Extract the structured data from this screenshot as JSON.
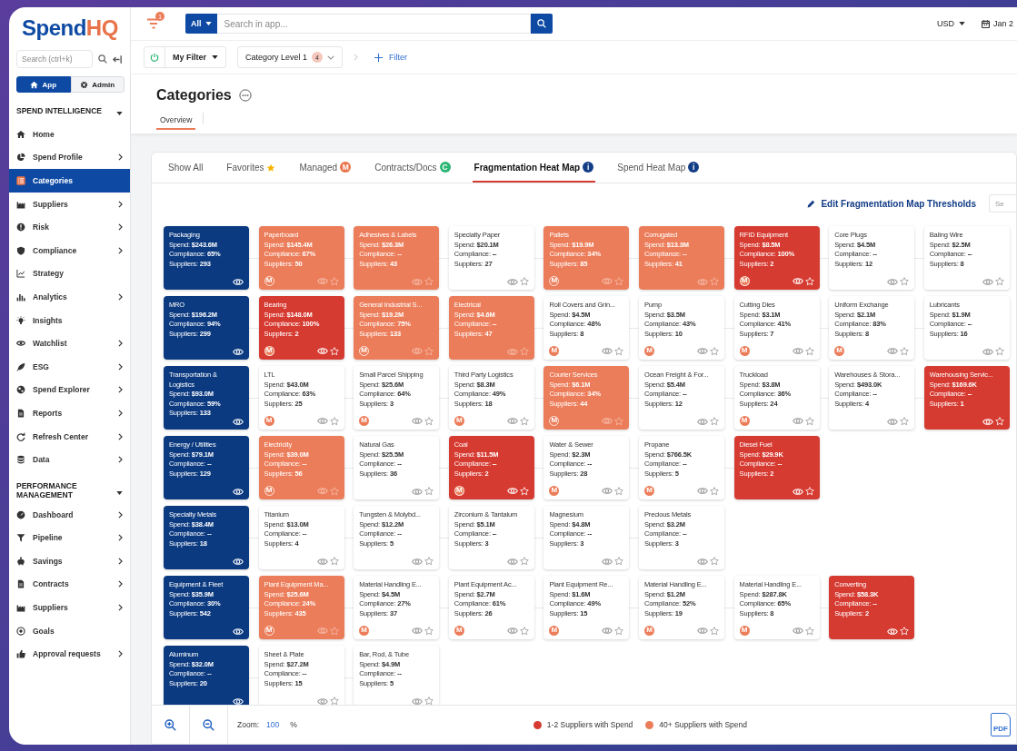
{
  "sidebar": {
    "logo": {
      "main": "Spend",
      "accent": "HQ"
    },
    "search": {
      "placeholder": "Search (ctrl+k)"
    },
    "modes": [
      {
        "label": "App",
        "selected": true
      },
      {
        "label": "Admin",
        "selected": false
      }
    ],
    "sections": [
      {
        "title": "SPEND INTELLIGENCE",
        "expanded": true,
        "items": [
          {
            "label": "Home",
            "has_submenu": false,
            "selected": false
          },
          {
            "label": "Spend Profile",
            "has_submenu": true,
            "selected": false
          },
          {
            "label": "Categories",
            "has_submenu": false,
            "selected": true
          },
          {
            "label": "Suppliers",
            "has_submenu": true,
            "selected": false
          },
          {
            "label": "Risk",
            "has_submenu": true,
            "selected": false
          },
          {
            "label": "Compliance",
            "has_submenu": true,
            "selected": false
          },
          {
            "label": "Strategy",
            "has_submenu": false,
            "selected": false
          },
          {
            "label": "Analytics",
            "has_submenu": true,
            "selected": false
          },
          {
            "label": "Insights",
            "has_submenu": false,
            "selected": false
          },
          {
            "label": "Watchlist",
            "has_submenu": true,
            "selected": false
          },
          {
            "label": "ESG",
            "has_submenu": true,
            "selected": false
          },
          {
            "label": "Spend Explorer",
            "has_submenu": true,
            "selected": false
          },
          {
            "label": "Reports",
            "has_submenu": true,
            "selected": false
          },
          {
            "label": "Refresh Center",
            "has_submenu": true,
            "selected": false
          },
          {
            "label": "Data",
            "has_submenu": true,
            "selected": false
          }
        ]
      },
      {
        "title": "PERFORMANCE MANAGEMENT",
        "expanded": true,
        "items": [
          {
            "label": "Dashboard",
            "has_submenu": true,
            "selected": false
          },
          {
            "label": "Pipeline",
            "has_submenu": true,
            "selected": false
          },
          {
            "label": "Savings",
            "has_submenu": true,
            "selected": false
          },
          {
            "label": "Contracts",
            "has_submenu": true,
            "selected": false
          },
          {
            "label": "Suppliers",
            "has_submenu": true,
            "selected": false
          },
          {
            "label": "Goals",
            "has_submenu": false,
            "selected": false
          },
          {
            "label": "Approval requests",
            "has_submenu": true,
            "selected": false
          }
        ]
      }
    ]
  },
  "top_bar": {
    "filter_badge": "1",
    "scope": "All",
    "search": {
      "placeholder": "Search in app..."
    },
    "currency": "USD",
    "date": "Jan 2"
  },
  "filter_bar": {
    "filter_name": "My Filter",
    "chips": [
      {
        "label": "Category Level 1",
        "count": "4"
      }
    ],
    "add_filter": "Filter"
  },
  "page": {
    "title": "Categories",
    "tabs": [
      {
        "label": "Overview",
        "selected": true
      }
    ]
  },
  "panel": {
    "tabs": [
      {
        "label": "Show All",
        "selected": false
      },
      {
        "label": "Favorites",
        "selected": false,
        "marker": {
          "kind": "star"
        }
      },
      {
        "label": "Managed",
        "selected": false,
        "marker": {
          "kind": "letter",
          "text": "M",
          "color": "#e8734a"
        }
      },
      {
        "label": "Contracts/Docs",
        "selected": false,
        "marker": {
          "kind": "letter",
          "text": "C",
          "color": "#2bb673"
        }
      },
      {
        "label": "Fragmentation Heat Map",
        "selected": true,
        "marker": {
          "kind": "letter",
          "text": "i",
          "color": "#123d86"
        }
      },
      {
        "label": "Spend Heat Map",
        "selected": false,
        "marker": {
          "kind": "letter",
          "text": "i",
          "color": "#123d86"
        }
      }
    ],
    "edit_link": "Edit Fragmentation Map Thresholds",
    "side_field": "Se",
    "rows": [
      [
        {
          "name": "Packaging",
          "kind": "parent",
          "lines": [
            "Spend: **$243.6M**",
            "Compliance: **65%**",
            "Suppliers: **293**"
          ]
        },
        {
          "name": "Paperboard",
          "kind": "high",
          "badge": "M",
          "lines": [
            "Spend: **$145.4M**",
            "Compliance: **67%**",
            "Suppliers: **50**"
          ]
        },
        {
          "name": "Adhesives & Labels",
          "kind": "high",
          "lines": [
            "Spend: **$26.3M**",
            "Compliance: **--**",
            "Suppliers: **43**"
          ]
        },
        {
          "name": "Specialty Paper",
          "kind": "normal",
          "lines": [
            "Spend: **$20.1M**",
            "Compliance: **--**",
            "Suppliers: **27**"
          ]
        },
        {
          "name": "Pallets",
          "kind": "high",
          "badge": "M",
          "lines": [
            "Spend: **$19.9M**",
            "Compliance: **34%**",
            "Suppliers: **85**"
          ]
        },
        {
          "name": "Corrugated",
          "kind": "high",
          "lines": [
            "Spend: **$13.3M**",
            "Compliance: **--**",
            "Suppliers: **41**"
          ]
        },
        {
          "name": "RFID Equipment",
          "kind": "low",
          "badge": "M",
          "lines": [
            "Spend: **$8.5M**",
            "Compliance: **100%**",
            "Suppliers: **2**"
          ]
        },
        {
          "name": "Core Plugs",
          "kind": "normal",
          "lines": [
            "Spend: **$4.5M**",
            "Compliance: **--**",
            "Suppliers: **12**"
          ]
        },
        {
          "name": "Baling Wire",
          "kind": "normal",
          "lines": [
            "Spend: **$2.5M**",
            "Compliance: **--**",
            "Suppliers: **8**"
          ]
        }
      ],
      [
        {
          "name": "MRO",
          "kind": "parent",
          "lines": [
            "Spend: **$196.2M**",
            "Compliance: **94%**",
            "Suppliers: **299**"
          ]
        },
        {
          "name": "Bearing",
          "kind": "low",
          "badge": "M",
          "lines": [
            "Spend: **$148.0M**",
            "Compliance: **100%**",
            "Suppliers: **2**"
          ]
        },
        {
          "name": "General Industrial S...",
          "kind": "high",
          "badge": "M",
          "lines": [
            "Spend: **$19.2M**",
            "Compliance: **75%**",
            "Suppliers: **133**"
          ]
        },
        {
          "name": "Electrical",
          "kind": "high",
          "lines": [
            "Spend: **$4.6M**",
            "Compliance: **--**",
            "Suppliers: **47**"
          ]
        },
        {
          "name": "Roll Covers and Grin...",
          "kind": "normal",
          "badge": "M",
          "lines": [
            "Spend: **$4.5M**",
            "Compliance: **48%**",
            "Suppliers: **8**"
          ]
        },
        {
          "name": "Pump",
          "kind": "normal",
          "badge": "M",
          "lines": [
            "Spend: **$3.5M**",
            "Compliance: **43%**",
            "Suppliers: **10**"
          ]
        },
        {
          "name": "Cutting Dies",
          "kind": "normal",
          "badge": "M",
          "lines": [
            "Spend: **$3.1M**",
            "Compliance: **41%**",
            "Suppliers: **7**"
          ]
        },
        {
          "name": "Uniform Exchange",
          "kind": "normal",
          "badge": "M",
          "lines": [
            "Spend: **$2.1M**",
            "Compliance: **83%**",
            "Suppliers: **8**"
          ]
        },
        {
          "name": "Lubricants",
          "kind": "normal",
          "lines": [
            "Spend: **$1.9M**",
            "Compliance: **--**",
            "Suppliers: **16**"
          ]
        }
      ],
      [
        {
          "name": "Transportation & Logistics",
          "kind": "parent",
          "lines": [
            "Spend: **$93.0M**",
            "Compliance: **59%**",
            "Suppliers: **133**"
          ]
        },
        {
          "name": "LTL",
          "kind": "normal",
          "badge": "M",
          "lines": [
            "Spend: **$43.0M**",
            "Compliance: **63%**",
            "Suppliers: **25**"
          ]
        },
        {
          "name": "Small Parcel Shipping",
          "kind": "normal",
          "badge": "M",
          "lines": [
            "Spend: **$25.6M**",
            "Compliance: **64%**",
            "Suppliers: **3**"
          ]
        },
        {
          "name": "Third Party Logistics",
          "kind": "normal",
          "badge": "M",
          "lines": [
            "Spend: **$8.3M**",
            "Compliance: **49%**",
            "Suppliers: **18**"
          ]
        },
        {
          "name": "Courier Services",
          "kind": "high",
          "badge": "M",
          "lines": [
            "Spend: **$6.1M**",
            "Compliance: **34%**",
            "Suppliers: **44**"
          ]
        },
        {
          "name": "Ocean Freight & For...",
          "kind": "normal",
          "lines": [
            "Spend: **$5.4M**",
            "Compliance: **--**",
            "Suppliers: **12**"
          ]
        },
        {
          "name": "Truckload",
          "kind": "normal",
          "badge": "M",
          "lines": [
            "Spend: **$3.8M**",
            "Compliance: **36%**",
            "Suppliers: **24**"
          ]
        },
        {
          "name": "Warehouses & Stora...",
          "kind": "normal",
          "lines": [
            "Spend: **$493.0K**",
            "Compliance: **--**",
            "Suppliers: **4**"
          ]
        },
        {
          "name": "Warehousing Servic...",
          "kind": "low",
          "lines": [
            "Spend: **$169.6K**",
            "Compliance: **--**",
            "Suppliers: **1**"
          ]
        }
      ],
      [
        {
          "name": "Energy / Utilities",
          "kind": "parent",
          "lines": [
            "Spend: **$79.1M**",
            "Compliance: **--**",
            "Suppliers: **129**"
          ]
        },
        {
          "name": "Electricity",
          "kind": "high",
          "badge": "M",
          "lines": [
            "Spend: **$39.0M**",
            "Compliance: **--**",
            "Suppliers: **56**"
          ]
        },
        {
          "name": "Natural Gas",
          "kind": "normal",
          "lines": [
            "Spend: **$25.5M**",
            "Compliance: **--**",
            "Suppliers: **36**"
          ]
        },
        {
          "name": "Coal",
          "kind": "low",
          "badge": "M",
          "lines": [
            "Spend: **$11.5M**",
            "Compliance: **--**",
            "Suppliers: **2**"
          ]
        },
        {
          "name": "Water & Sewer",
          "kind": "normal",
          "badge": "M",
          "lines": [
            "Spend: **$2.3M**",
            "Compliance: **--**",
            "Suppliers: **28**"
          ]
        },
        {
          "name": "Propane",
          "kind": "normal",
          "badge": "M",
          "lines": [
            "Spend: **$766.5K**",
            "Compliance: **--**",
            "Suppliers: **5**"
          ]
        },
        {
          "name": "Diesel Fuel",
          "kind": "low",
          "lines": [
            "Spend: **$29.9K**",
            "Compliance: **--**",
            "Suppliers: **2**"
          ]
        }
      ],
      [
        {
          "name": "Specialty Metals",
          "kind": "parent",
          "lines": [
            "Spend: **$38.4M**",
            "Compliance: **--**",
            "Suppliers: **18**"
          ]
        },
        {
          "name": "Titanium",
          "kind": "normal",
          "lines": [
            "Spend: **$13.0M**",
            "Compliance: **--**",
            "Suppliers: **4**"
          ]
        },
        {
          "name": "Tungsten & Molybd...",
          "kind": "normal",
          "lines": [
            "Spend: **$12.2M**",
            "Compliance: **--**",
            "Suppliers: **5**"
          ]
        },
        {
          "name": "Zirconium & Tantalum",
          "kind": "normal",
          "lines": [
            "Spend: **$5.1M**",
            "Compliance: **--**",
            "Suppliers: **3**"
          ]
        },
        {
          "name": "Magnesium",
          "kind": "normal",
          "lines": [
            "Spend: **$4.8M**",
            "Compliance: **--**",
            "Suppliers: **3**"
          ]
        },
        {
          "name": "Precious Metals",
          "kind": "normal",
          "lines": [
            "Spend: **$3.2M**",
            "Compliance: **--**",
            "Suppliers: **3**"
          ]
        }
      ],
      [
        {
          "name": "Equipment & Fleet",
          "kind": "parent",
          "lines": [
            "Spend: **$35.9M**",
            "Compliance: **30%**",
            "Suppliers: **542**"
          ]
        },
        {
          "name": "Plant Equipment Ma...",
          "kind": "high",
          "badge": "M",
          "lines": [
            "Spend: **$25.6M**",
            "Compliance: **24%**",
            "Suppliers: **435**"
          ]
        },
        {
          "name": "Material Handling E...",
          "kind": "normal",
          "badge": "M",
          "lines": [
            "Spend: **$4.5M**",
            "Compliance: **27%**",
            "Suppliers: **37**"
          ]
        },
        {
          "name": "Plant Equipment Ac...",
          "kind": "normal",
          "badge": "M",
          "lines": [
            "Spend: **$2.7M**",
            "Compliance: **61%**",
            "Suppliers: **26**"
          ]
        },
        {
          "name": "Plant Equipment Re...",
          "kind": "normal",
          "badge": "M",
          "lines": [
            "Spend: **$1.6M**",
            "Compliance: **49%**",
            "Suppliers: **15**"
          ]
        },
        {
          "name": "Material Handling E...",
          "kind": "normal",
          "badge": "M",
          "lines": [
            "Spend: **$1.2M**",
            "Compliance: **52%**",
            "Suppliers: **19**"
          ]
        },
        {
          "name": "Material Handling E...",
          "kind": "normal",
          "badge": "M",
          "lines": [
            "Spend: **$287.8K**",
            "Compliance: **65%**",
            "Suppliers: **8**"
          ]
        },
        {
          "name": "Converting",
          "kind": "low",
          "lines": [
            "Spend: **$58.3K**",
            "Compliance: **--**",
            "Suppliers: **2**"
          ]
        }
      ],
      [
        {
          "name": "Aluminum",
          "kind": "parent",
          "lines": [
            "Spend: **$32.0M**",
            "Compliance: **--**",
            "Suppliers: **20**"
          ]
        },
        {
          "name": "Sheet & Plate",
          "kind": "normal",
          "lines": [
            "Spend: **$27.2M**",
            "Compliance: **--**",
            "Suppliers: **15**"
          ]
        },
        {
          "name": "Bar, Rod, & Tube",
          "kind": "normal",
          "lines": [
            "Spend: **$4.9M**",
            "Compliance: **--**",
            "Suppliers: **5**"
          ]
        }
      ]
    ],
    "zoom": {
      "label": "Zoom:",
      "value": "100",
      "unit": "%"
    },
    "legend": [
      {
        "label": "1-2 Suppliers with Spend",
        "color": "#d63b32"
      },
      {
        "label": "40+ Suppliers with Spend",
        "color": "#ec7d5a"
      }
    ],
    "export_label": "PDF"
  }
}
